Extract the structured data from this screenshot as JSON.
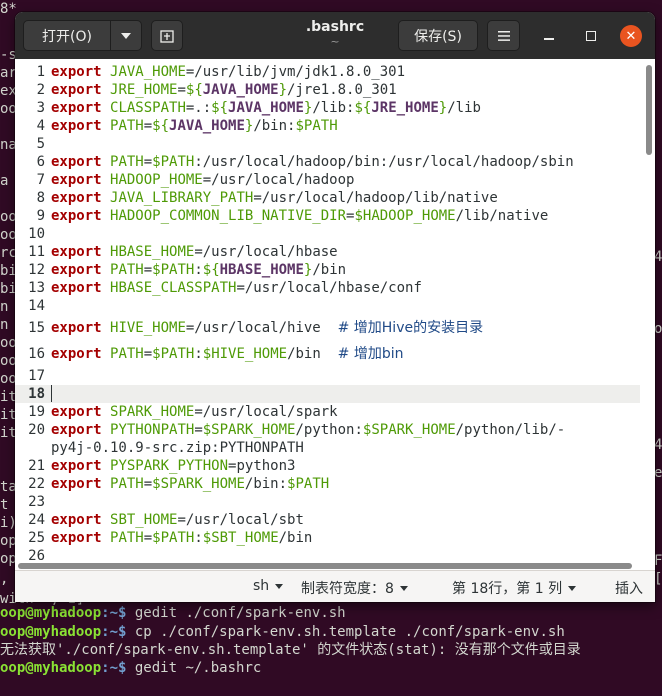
{
  "terminal": {
    "side_fragments": [
      {
        "text": "8*"
      },
      {
        "text": "-s"
      },
      {
        "text": "ark"
      },
      {
        "text": "ex"
      },
      {
        "text": "oop"
      },
      {
        "text": "nan"
      },
      {
        "text": "a"
      },
      {
        "text": "oop"
      },
      {
        "text": "oop"
      },
      {
        "text": "rce"
      },
      {
        "text": "bil"
      },
      {
        "text": "bil"
      },
      {
        "text": "n s"
      },
      {
        "text": "n c"
      },
      {
        "text": "oop"
      },
      {
        "text": "oop"
      },
      {
        "text": "oop"
      },
      {
        "text": "ite"
      },
      {
        "text": "ite"
      },
      {
        "text": "ite"
      },
      {
        "text": "ta"
      },
      {
        "text": "t ("
      },
      {
        "text": "i)"
      },
      {
        "text": "op"
      },
      {
        "text": "op"
      },
      {
        "text": ","
      }
    ],
    "right_fragments": [
      {
        "text": "4"
      },
      {
        "text": "or"
      },
      {
        "text": "4"
      },
      {
        "text": "e"
      },
      {
        "text": "Fe"
      },
      {
        "text": "[j"
      }
    ],
    "partial_line": "with ', 1]",
    "prompt_user": "oop@myhadoop",
    "prompt_path": ":~$",
    "lines": [
      {
        "cmd": " gedit ./conf/spark-env.sh"
      },
      {
        "cmd": " cp ./conf/spark-env.sh.template ./conf/spark-env.sh"
      },
      {
        "cmd": " gedit ~/.bashrc"
      }
    ],
    "error_line": "无法获取'./conf/spark-env.sh.template' 的文件状态(stat): 没有那个文件或目录"
  },
  "header": {
    "open_label": "打开(O)",
    "title": ".bashrc",
    "subtitle": "~",
    "save_label": "保存(S)"
  },
  "editor": {
    "current_line": 18,
    "lines": [
      {
        "num": "1",
        "parts": [
          {
            "t": "kw",
            "v": "export"
          },
          {
            "t": "txt",
            "v": " "
          },
          {
            "t": "var",
            "v": "JAVA_HOME"
          },
          {
            "t": "txt",
            "v": "=/usr/lib/jvm/jdk1.8.0_301"
          }
        ]
      },
      {
        "num": "2",
        "parts": [
          {
            "t": "kw",
            "v": "export"
          },
          {
            "t": "txt",
            "v": " "
          },
          {
            "t": "var",
            "v": "JRE_HOME"
          },
          {
            "t": "txt",
            "v": "="
          },
          {
            "t": "var",
            "v": "${"
          },
          {
            "t": "sub",
            "v": "JAVA_HOME"
          },
          {
            "t": "var",
            "v": "}"
          },
          {
            "t": "txt",
            "v": "/jre1.8.0_301"
          }
        ]
      },
      {
        "num": "3",
        "parts": [
          {
            "t": "kw",
            "v": "export"
          },
          {
            "t": "txt",
            "v": " "
          },
          {
            "t": "var",
            "v": "CLASSPATH"
          },
          {
            "t": "txt",
            "v": "=.:"
          },
          {
            "t": "var",
            "v": "${"
          },
          {
            "t": "sub",
            "v": "JAVA_HOME"
          },
          {
            "t": "var",
            "v": "}"
          },
          {
            "t": "txt",
            "v": "/lib:"
          },
          {
            "t": "var",
            "v": "${"
          },
          {
            "t": "sub",
            "v": "JRE_HOME"
          },
          {
            "t": "var",
            "v": "}"
          },
          {
            "t": "txt",
            "v": "/lib"
          }
        ]
      },
      {
        "num": "4",
        "parts": [
          {
            "t": "kw",
            "v": "export"
          },
          {
            "t": "txt",
            "v": " "
          },
          {
            "t": "var",
            "v": "PATH"
          },
          {
            "t": "txt",
            "v": "="
          },
          {
            "t": "var",
            "v": "${"
          },
          {
            "t": "sub",
            "v": "JAVA_HOME"
          },
          {
            "t": "var",
            "v": "}"
          },
          {
            "t": "txt",
            "v": "/bin:"
          },
          {
            "t": "var",
            "v": "$PATH"
          }
        ]
      },
      {
        "num": "5",
        "parts": []
      },
      {
        "num": "6",
        "parts": [
          {
            "t": "kw",
            "v": "export"
          },
          {
            "t": "txt",
            "v": " "
          },
          {
            "t": "var",
            "v": "PATH"
          },
          {
            "t": "txt",
            "v": "="
          },
          {
            "t": "var",
            "v": "$PATH"
          },
          {
            "t": "txt",
            "v": ":/usr/local/hadoop/bin:/usr/local/hadoop/sbin"
          }
        ]
      },
      {
        "num": "7",
        "parts": [
          {
            "t": "kw",
            "v": "export"
          },
          {
            "t": "txt",
            "v": " "
          },
          {
            "t": "var",
            "v": "HADOOP_HOME"
          },
          {
            "t": "txt",
            "v": "=/usr/local/hadoop"
          }
        ]
      },
      {
        "num": "8",
        "parts": [
          {
            "t": "kw",
            "v": "export"
          },
          {
            "t": "txt",
            "v": " "
          },
          {
            "t": "var",
            "v": "JAVA_LIBRARY_PATH"
          },
          {
            "t": "txt",
            "v": "=/usr/local/hadoop/lib/native"
          }
        ]
      },
      {
        "num": "9",
        "parts": [
          {
            "t": "kw",
            "v": "export"
          },
          {
            "t": "txt",
            "v": " "
          },
          {
            "t": "var",
            "v": "HADOOP_COMMON_LIB_NATIVE_DIR"
          },
          {
            "t": "txt",
            "v": "="
          },
          {
            "t": "var",
            "v": "$HADOOP_HOME"
          },
          {
            "t": "txt",
            "v": "/lib/native"
          }
        ]
      },
      {
        "num": "10",
        "parts": []
      },
      {
        "num": "11",
        "parts": [
          {
            "t": "kw",
            "v": "export"
          },
          {
            "t": "txt",
            "v": " "
          },
          {
            "t": "var",
            "v": "HBASE_HOME"
          },
          {
            "t": "txt",
            "v": "=/usr/local/hbase"
          }
        ]
      },
      {
        "num": "12",
        "parts": [
          {
            "t": "kw",
            "v": "export"
          },
          {
            "t": "txt",
            "v": " "
          },
          {
            "t": "var",
            "v": "PATH"
          },
          {
            "t": "txt",
            "v": "="
          },
          {
            "t": "var",
            "v": "$PATH"
          },
          {
            "t": "txt",
            "v": ":"
          },
          {
            "t": "var",
            "v": "${"
          },
          {
            "t": "sub",
            "v": "HBASE_HOME"
          },
          {
            "t": "var",
            "v": "}"
          },
          {
            "t": "txt",
            "v": "/bin"
          }
        ]
      },
      {
        "num": "13",
        "parts": [
          {
            "t": "kw",
            "v": "export"
          },
          {
            "t": "txt",
            "v": " "
          },
          {
            "t": "var",
            "v": "HBASE_CLASSPATH"
          },
          {
            "t": "txt",
            "v": "=/usr/local/hbase/conf"
          }
        ]
      },
      {
        "num": "14",
        "parts": []
      },
      {
        "num": "15",
        "parts": [
          {
            "t": "kw",
            "v": "export"
          },
          {
            "t": "txt",
            "v": " "
          },
          {
            "t": "var",
            "v": "HIVE_HOME"
          },
          {
            "t": "txt",
            "v": "=/usr/local/hive  "
          },
          {
            "t": "cm",
            "v": "# 增加Hive的安装目录"
          }
        ]
      },
      {
        "num": "16",
        "parts": [
          {
            "t": "kw",
            "v": "export"
          },
          {
            "t": "txt",
            "v": " "
          },
          {
            "t": "var",
            "v": "PATH"
          },
          {
            "t": "txt",
            "v": "="
          },
          {
            "t": "var",
            "v": "$PATH"
          },
          {
            "t": "txt",
            "v": ":"
          },
          {
            "t": "var",
            "v": "$HIVE_HOME"
          },
          {
            "t": "txt",
            "v": "/bin  "
          },
          {
            "t": "cm",
            "v": "# 增加bin"
          }
        ]
      },
      {
        "num": "17",
        "parts": []
      },
      {
        "num": "18",
        "parts": []
      },
      {
        "num": "19",
        "parts": [
          {
            "t": "kw",
            "v": "export"
          },
          {
            "t": "txt",
            "v": " "
          },
          {
            "t": "var",
            "v": "SPARK_HOME"
          },
          {
            "t": "txt",
            "v": "=/usr/local/spark"
          }
        ]
      },
      {
        "num": "20",
        "parts": [
          {
            "t": "kw",
            "v": "export"
          },
          {
            "t": "txt",
            "v": " "
          },
          {
            "t": "var",
            "v": "PYTHONPATH"
          },
          {
            "t": "txt",
            "v": "="
          },
          {
            "t": "var",
            "v": "$SPARK_HOME"
          },
          {
            "t": "txt",
            "v": "/python:"
          },
          {
            "t": "var",
            "v": "$SPARK_HOME"
          },
          {
            "t": "txt",
            "v": "/python/lib/-"
          }
        ]
      },
      {
        "num": "",
        "parts": [
          {
            "t": "txt",
            "v": "py4j-0.10.9-src.zip:PYTHONPATH"
          }
        ]
      },
      {
        "num": "21",
        "parts": [
          {
            "t": "kw",
            "v": "export"
          },
          {
            "t": "txt",
            "v": " "
          },
          {
            "t": "var",
            "v": "PYSPARK_PYTHON"
          },
          {
            "t": "txt",
            "v": "=python3"
          }
        ]
      },
      {
        "num": "22",
        "parts": [
          {
            "t": "kw",
            "v": "export"
          },
          {
            "t": "txt",
            "v": " "
          },
          {
            "t": "var",
            "v": "PATH"
          },
          {
            "t": "txt",
            "v": "="
          },
          {
            "t": "var",
            "v": "$SPARK_HOME"
          },
          {
            "t": "txt",
            "v": "/bin:"
          },
          {
            "t": "var",
            "v": "$PATH"
          }
        ]
      },
      {
        "num": "23",
        "parts": []
      },
      {
        "num": "24",
        "parts": [
          {
            "t": "kw",
            "v": "export"
          },
          {
            "t": "txt",
            "v": " "
          },
          {
            "t": "var",
            "v": "SBT_HOME"
          },
          {
            "t": "txt",
            "v": "=/usr/local/sbt"
          }
        ]
      },
      {
        "num": "25",
        "parts": [
          {
            "t": "kw",
            "v": "export"
          },
          {
            "t": "txt",
            "v": " "
          },
          {
            "t": "var",
            "v": "PATH"
          },
          {
            "t": "txt",
            "v": "="
          },
          {
            "t": "var",
            "v": "$PATH"
          },
          {
            "t": "txt",
            "v": ":"
          },
          {
            "t": "var",
            "v": "$SBT_HOME"
          },
          {
            "t": "txt",
            "v": "/bin"
          }
        ]
      },
      {
        "num": "26",
        "parts": []
      }
    ]
  },
  "statusbar": {
    "language": "sh",
    "tab_width": "制表符宽度：8",
    "position": "第 18行，第 1 列",
    "mode": "插入"
  }
}
